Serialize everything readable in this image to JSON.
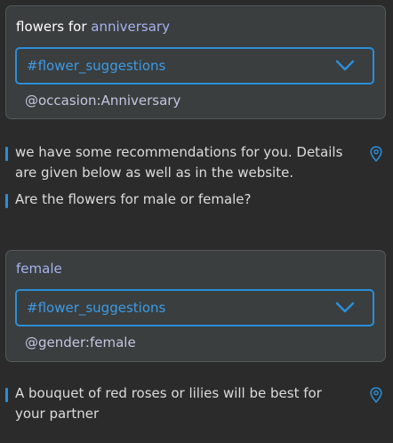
{
  "turn1": {
    "user": {
      "plain": "flowers for ",
      "entity": "anniversary"
    },
    "intent": "#flower_suggestions",
    "slot": "@occasion:Anniversary"
  },
  "bot1": {
    "line1": "we have some recommendations for you. Details are given below as well as in the website.",
    "line2": "Are the flowers for male or female?"
  },
  "turn2": {
    "user": {
      "entity": "female"
    },
    "intent": "#flower_suggestions",
    "slot": "@gender:female"
  },
  "bot2": {
    "line1": "A bouquet of red roses or lilies will be best for your partner"
  },
  "icons": {
    "dropdown": "chevron-down-icon",
    "pin": "location-pin-icon"
  },
  "colors": {
    "accent": "#2b8ed8",
    "entity": "#a7b3f0",
    "card": "#3a3e3e",
    "background": "#2b2b2b"
  }
}
